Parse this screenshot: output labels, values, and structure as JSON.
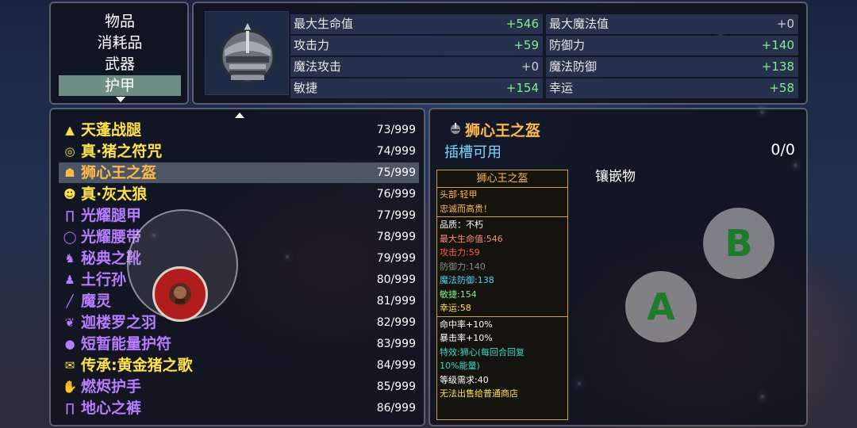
{
  "categories": [
    {
      "label": "物品"
    },
    {
      "label": "消耗品"
    },
    {
      "label": "武器"
    },
    {
      "label": "护甲",
      "selected": true
    }
  ],
  "stats": [
    {
      "label": "最大生命值",
      "value": "+546"
    },
    {
      "label": "最大魔法值",
      "value": "+0"
    },
    {
      "label": "攻击力",
      "value": "+59"
    },
    {
      "label": "防御力",
      "value": "+140"
    },
    {
      "label": "魔法攻击",
      "value": "+0"
    },
    {
      "label": "魔法防御",
      "value": "+138"
    },
    {
      "label": "敏捷",
      "value": "+154"
    },
    {
      "label": "幸运",
      "value": "+58"
    }
  ],
  "items": [
    {
      "name": "天蓬战腿",
      "count": "73/999",
      "color": "#ffe14a",
      "icon": "boots-icon",
      "glyph": "▲"
    },
    {
      "name": "真·猪之符咒",
      "count": "74/999",
      "color": "#ffe14a",
      "icon": "amulet-icon",
      "glyph": "◎"
    },
    {
      "name": "狮心王之盔",
      "count": "75/999",
      "color": "#ffb94a",
      "icon": "helmet-icon",
      "glyph": "☗",
      "selected": true
    },
    {
      "name": "真·灰太狼",
      "count": "76/999",
      "color": "#ffe14a",
      "icon": "wolf-icon",
      "glyph": "☻"
    },
    {
      "name": "光耀腿甲",
      "count": "77/999",
      "color": "#b77cff",
      "icon": "leggings-icon",
      "glyph": "∏"
    },
    {
      "name": "光耀腰带",
      "count": "78/999",
      "color": "#b77cff",
      "icon": "belt-icon",
      "glyph": "◯"
    },
    {
      "name": "秘典之靴",
      "count": "79/999",
      "color": "#b77cff",
      "icon": "boots-icon",
      "glyph": "♞"
    },
    {
      "name": "土行孙",
      "count": "80/999",
      "color": "#b77cff",
      "icon": "boot-icon",
      "glyph": "♟"
    },
    {
      "name": "魔灵",
      "count": "81/999",
      "color": "#b77cff",
      "icon": "wand-icon",
      "glyph": "╱"
    },
    {
      "name": "迦楼罗之羽",
      "count": "82/999",
      "color": "#b77cff",
      "icon": "feather-icon",
      "glyph": "❦"
    },
    {
      "name": "短暂能量护符",
      "count": "83/999",
      "color": "#b77cff",
      "icon": "orb-icon",
      "glyph": "●"
    },
    {
      "name": "传承:黄金猪之歌",
      "count": "84/999",
      "color": "#ffe14a",
      "icon": "scroll-icon",
      "glyph": "✉"
    },
    {
      "name": "燃烬护手",
      "count": "85/999",
      "color": "#b77cff",
      "icon": "gauntlet-icon",
      "glyph": "✋"
    },
    {
      "name": "地心之裤",
      "count": "86/999",
      "color": "#b77cff",
      "icon": "pants-icon",
      "glyph": "∏"
    }
  ],
  "detail": {
    "title": "狮心王之盔",
    "slot_label": "插槽可用",
    "slot_value": "0/0",
    "inlay_label": "镶嵌物",
    "tooltip": {
      "header": "狮心王之盔",
      "lines1": [
        {
          "text": "头部·轻甲",
          "color": "#ffb94a"
        },
        {
          "text": "忠诚而高贵！",
          "color": "#ffb94a"
        }
      ],
      "lines2": [
        {
          "text": "品质：不朽",
          "color": "#ffffff"
        },
        {
          "text": "最大生命值:546",
          "color": "#ff8a78"
        },
        {
          "text": "攻击力:59",
          "color": "#ff5a4a"
        },
        {
          "text": "防御力:140",
          "color": "#8a8a8a"
        },
        {
          "text": "魔法防御:138",
          "color": "#58d0ff"
        },
        {
          "text": "敏捷:154",
          "color": "#7cf08c"
        },
        {
          "text": "幸运:58",
          "color": "#ffe14a"
        }
      ],
      "lines3": [
        {
          "text": "命中率+10%",
          "color": "#ffffff"
        },
        {
          "text": "暴击率+10%",
          "color": "#ffffff"
        },
        {
          "text": "特效:狮心(每回合回复",
          "color": "#3fd6c8"
        },
        {
          "text": "10%能量)",
          "color": "#3fd6c8"
        },
        {
          "text": "等级需求:40",
          "color": "#ffffff"
        },
        {
          "text": "无法出售给普通商店",
          "color": "#ffe14a"
        }
      ]
    }
  },
  "controls": {
    "a_label": "A",
    "b_label": "B"
  }
}
